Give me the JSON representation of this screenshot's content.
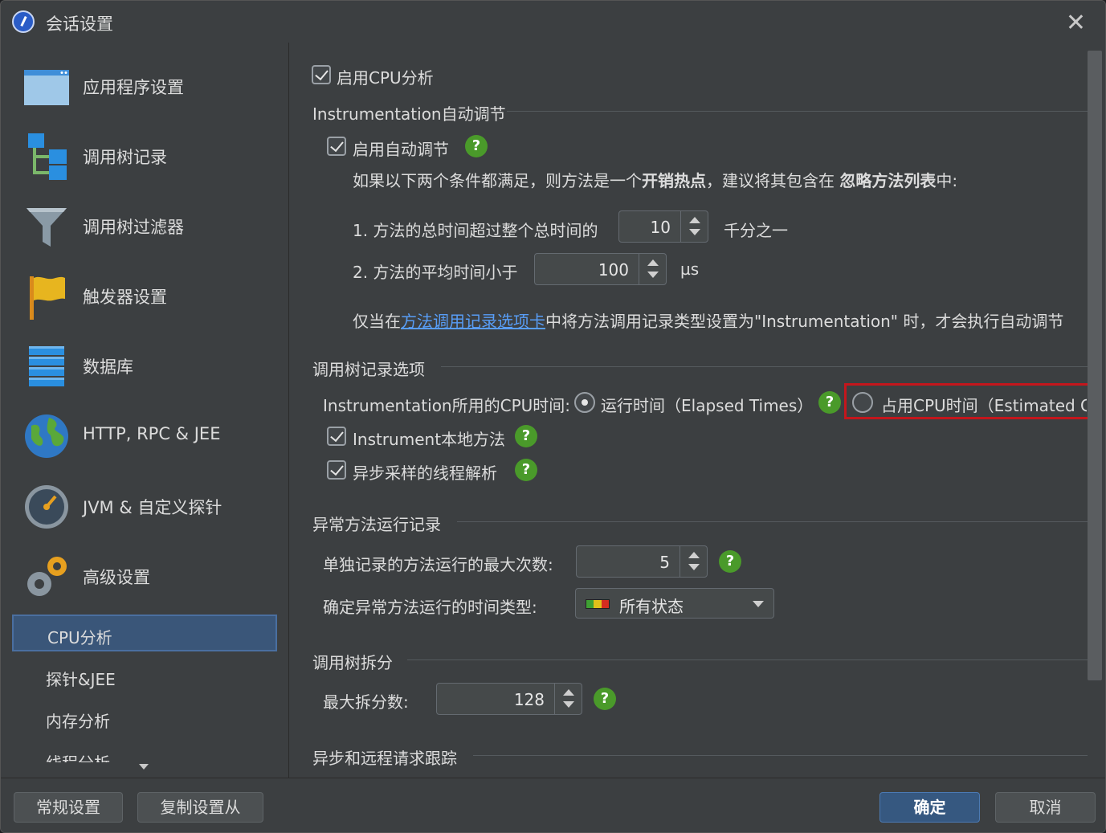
{
  "window": {
    "title": "会话设置"
  },
  "sidebar": {
    "items": [
      {
        "label": "应用程序设置",
        "icon": "window-icon"
      },
      {
        "label": "调用树记录",
        "icon": "tree-icon"
      },
      {
        "label": "调用树过滤器",
        "icon": "funnel-icon"
      },
      {
        "label": "触发器设置",
        "icon": "flag-icon"
      },
      {
        "label": "数据库",
        "icon": "database-icon"
      },
      {
        "label": "HTTP, RPC & JEE",
        "icon": "globe-icon"
      },
      {
        "label": "JVM & 自定义探针",
        "icon": "gauge-icon"
      },
      {
        "label": "高级设置",
        "icon": "gears-icon"
      }
    ],
    "subitems": [
      {
        "label": "CPU分析",
        "selected": true
      },
      {
        "label": "探针&JEE"
      },
      {
        "label": "内存分析"
      },
      {
        "label": "线程分析"
      }
    ]
  },
  "main": {
    "enable_cpu": "启用CPU分析",
    "auto_tune": {
      "section": "Instrumentation自动调节",
      "enable": "启用自动调节",
      "desc_pre": "如果以下两个条件都满足，则方法是一个",
      "desc_bold1": "开销热点",
      "desc_mid": "，建议将其包含在 ",
      "desc_bold2": "忽略方法列表",
      "desc_post": "中:",
      "cond1_label": "1. 方法的总时间超过整个总时间的",
      "cond1_value": "10",
      "cond1_unit": "千分之一",
      "cond2_label": "2. 方法的平均时间小于",
      "cond2_value": "100",
      "cond2_unit": "µs",
      "note_pre": "仅当在",
      "note_link": "方法调用记录选项卡",
      "note_post": "中将方法调用记录类型设置为\"Instrumentation\" 时，才会执行自动调节"
    },
    "tree_options": {
      "section": "调用树记录选项",
      "cpu_time_label": "Instrumentation所用的CPU时间:",
      "radio_elapsed": "运行时间（Elapsed Times）",
      "radio_cpu": "占用CPU时间（Estimated CI",
      "instrument_native": "Instrument本地方法",
      "async_thread": "异步采样的线程解析"
    },
    "exceptional": {
      "section": "异常方法运行记录",
      "max_label": "单独记录的方法运行的最大次数:",
      "max_value": "5",
      "time_type_label": "确定异常方法运行的时间类型:",
      "time_type_value": "所有状态"
    },
    "tree_split": {
      "section": "调用树拆分",
      "max_label": "最大拆分数:",
      "max_value": "128"
    },
    "async_section": "异步和远程请求跟踪"
  },
  "footer": {
    "general": "常规设置",
    "copy_from": "复制设置从",
    "ok": "确定",
    "cancel": "取消"
  },
  "colors": {
    "accent": "#365880",
    "help_green": "#4a9a2a",
    "highlight": "#c4161c"
  }
}
